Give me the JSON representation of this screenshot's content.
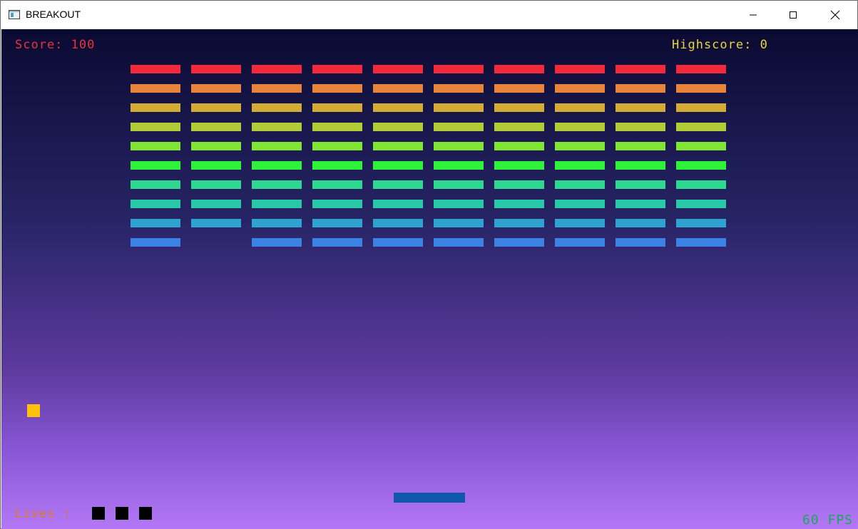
{
  "window": {
    "title": "BREAKOUT"
  },
  "hud": {
    "score": "Score: 100",
    "highscore": "Highscore: 0",
    "lives_label": "Lives :",
    "lives_count": 3,
    "fps": "60 FPS"
  },
  "bricks": {
    "columns": 10,
    "row_colors": [
      "#f2293b",
      "#e8843a",
      "#d4ac35",
      "#b2cc37",
      "#80e633",
      "#2ff23a",
      "#2fd890",
      "#29c8a8",
      "#2ea3cf",
      "#3a82e3"
    ],
    "missing": [
      [
        9,
        1
      ]
    ]
  },
  "colors": {
    "paddle": "#0d58a8",
    "ball": "#ffc107"
  }
}
